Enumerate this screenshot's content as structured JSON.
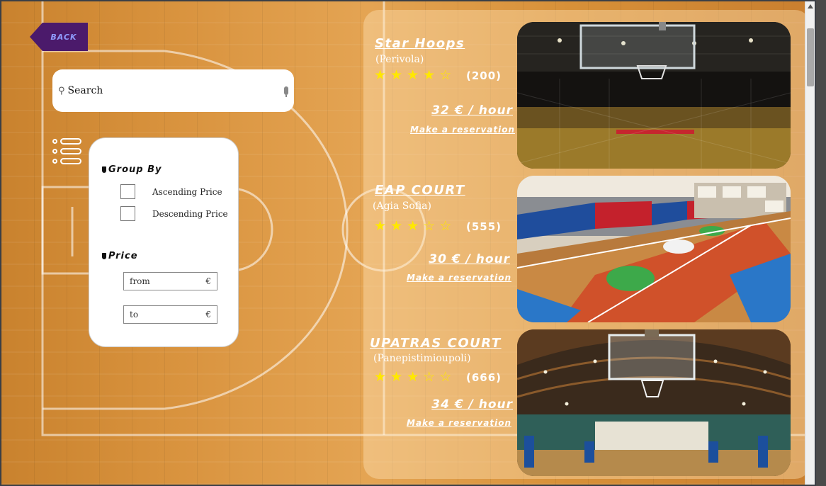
{
  "back_button": {
    "label": "BACK"
  },
  "search": {
    "placeholder": "Search",
    "icon": "search-icon"
  },
  "filters": {
    "group_by": {
      "title": "Group By",
      "options": [
        "Ascending Price",
        "Descending Price"
      ]
    },
    "price": {
      "title": "Price",
      "from_placeholder": "from",
      "to_placeholder": "to",
      "currency": "€"
    }
  },
  "courts": [
    {
      "name": "Star Hoops",
      "area": "(Perivola)",
      "rating": 4,
      "rating_max": 5,
      "reviews": "(200)",
      "price": "32 € / hour",
      "action": "Make a reservation"
    },
    {
      "name": "EAP COURT",
      "area": "(Agia Sofia)",
      "rating": 3,
      "rating_max": 5,
      "reviews": "(555)",
      "price": "30 € / hour",
      "action": "Make a reservation"
    },
    {
      "name": "UPATRAS COURT",
      "area": "(Panepistimioupoli)",
      "rating": 3,
      "rating_max": 5,
      "reviews": "(666)",
      "price": "34 € / hour",
      "action": "Make a reservation"
    }
  ],
  "colors": {
    "accent_purple": "#4b1a6b",
    "back_text": "#8f9bff",
    "star": "#ffe800"
  }
}
